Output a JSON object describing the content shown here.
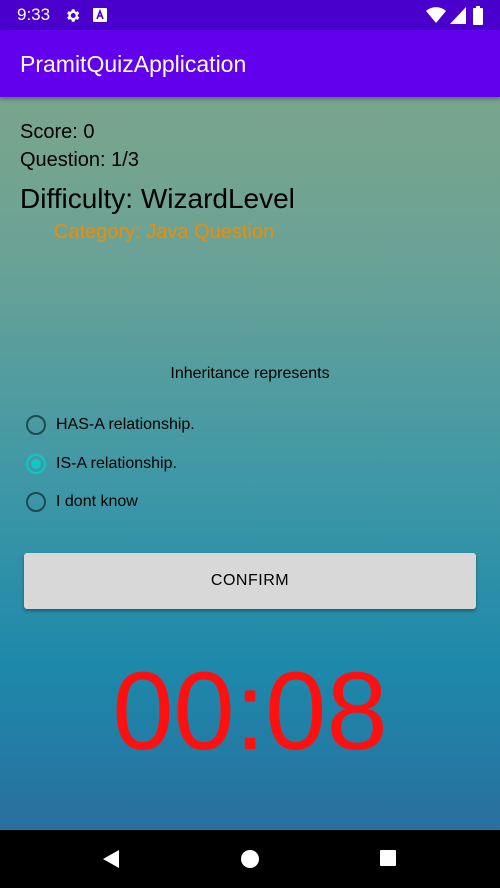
{
  "status_bar": {
    "time": "9:33",
    "icons": [
      "gear-icon",
      "a-badge-icon",
      "wifi-icon",
      "signal-icon",
      "battery-icon"
    ]
  },
  "app_bar": {
    "title": "PramitQuizApplication",
    "color": "#6200ee"
  },
  "quiz": {
    "score": "Score: 0",
    "question_count": "Question: 1/3",
    "difficulty": "Difficulty: WizardLevel",
    "category": "Category: Java Question",
    "question": "Inheritance represents",
    "options": [
      {
        "label": "HAS-A relationship.",
        "selected": false
      },
      {
        "label": "IS-A relationship.",
        "selected": true
      },
      {
        "label": "I dont know",
        "selected": false
      }
    ],
    "confirm_label": "CONFIRM",
    "timer": "00:08"
  },
  "colors": {
    "category": "#f08c00",
    "timer": "#ff1010",
    "radio_selected": "#11c7c4"
  },
  "nav_bar": {
    "icons": [
      "back-icon",
      "home-icon",
      "recents-icon"
    ]
  }
}
